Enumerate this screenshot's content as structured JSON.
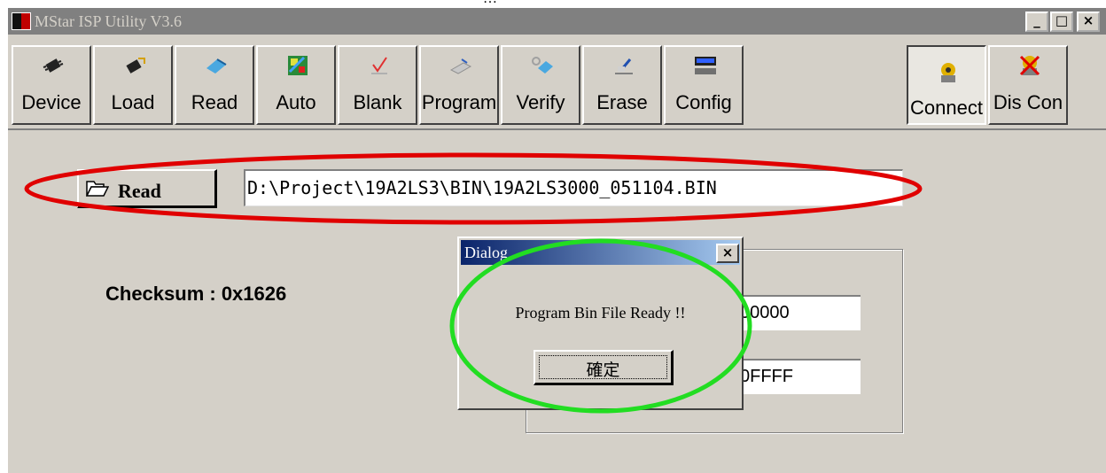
{
  "window": {
    "title": "MStar ISP Utility V3.6",
    "controls": {
      "minimize": "_",
      "maximize": "□",
      "close": "×"
    }
  },
  "toolbar": {
    "buttons": [
      {
        "label": "Device",
        "icon": "chip-icon"
      },
      {
        "label": "Load",
        "icon": "chip-load-icon"
      },
      {
        "label": "Read",
        "icon": "read-icon"
      },
      {
        "label": "Auto",
        "icon": "auto-icon"
      },
      {
        "label": "Blank",
        "icon": "blank-check-icon"
      },
      {
        "label": "Program",
        "icon": "program-icon"
      },
      {
        "label": "Verify",
        "icon": "verify-icon"
      },
      {
        "label": "Erase",
        "icon": "erase-icon"
      },
      {
        "label": "Config",
        "icon": "config-icon"
      },
      {
        "label": "Connect",
        "icon": "connect-icon",
        "pressed": true
      },
      {
        "label": "Dis Con",
        "icon": "disconnect-icon"
      }
    ]
  },
  "file": {
    "read_button_label": "Read",
    "path": "D:\\Project\\19A2LS3\\BIN\\19A2LS3000_051104.BIN"
  },
  "checksum": "Checksum : 0x1626",
  "address": {
    "start_visible": "00000",
    "end_visible": "0FFFF"
  },
  "dialog": {
    "title": "Dialog",
    "message": "Program Bin File Ready !!",
    "ok_label": "確定",
    "close_label": "×"
  },
  "colors": {
    "window_bg": "#d4d0c8",
    "titlebar_inactive": "#808080",
    "dialog_title_start": "#0a246a",
    "dialog_title_end": "#a6caf0",
    "highlight_red": "#e00000",
    "highlight_green": "#22dd22"
  }
}
